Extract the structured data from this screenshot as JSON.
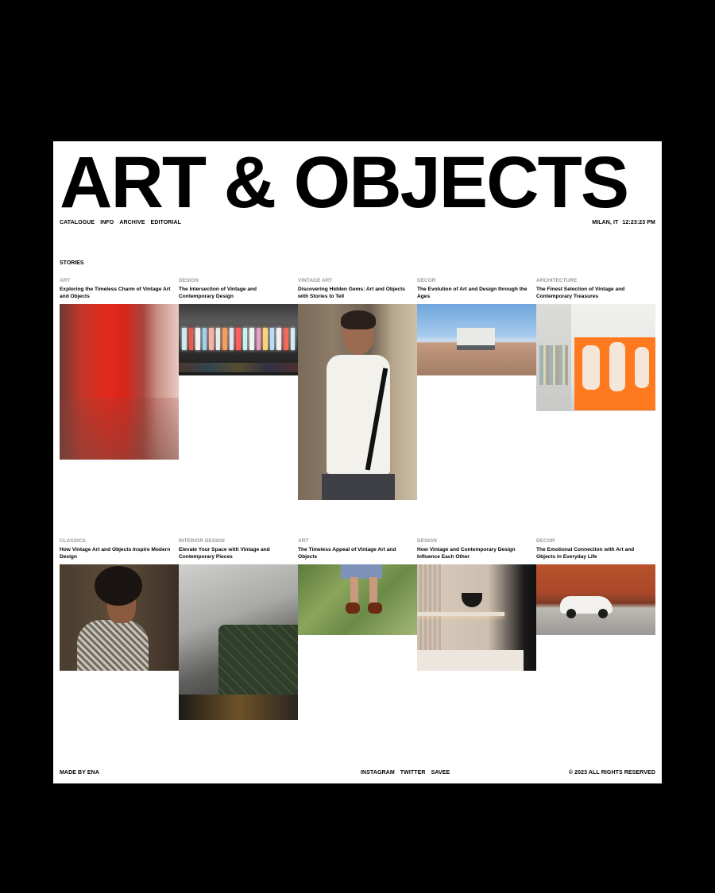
{
  "hero_title": "ART & OBJECTS",
  "nav": [
    "CATALOGUE",
    "INFO",
    "ARCHIVE",
    "EDITORIAL"
  ],
  "meta": {
    "location": "MILAN, IT",
    "time": "12:23:23 PM"
  },
  "stories_label": "STORIES",
  "stories": [
    {
      "category": "ART",
      "title": "Exploring the Timeless Charm of Vintage Art and Objects"
    },
    {
      "category": "DESIGN",
      "title": "The Intersection of Vintage and Contemporary Design"
    },
    {
      "category": "VINTAGE ART",
      "title": "Discovering Hidden Gems: Art and Objects with Stories to Tell"
    },
    {
      "category": "DECOR",
      "title": "The Evolution of Art and Design through the Ages"
    },
    {
      "category": "ARCHITECTURE",
      "title": "The Finest Selection of Vintage and Contemporary Treasures"
    },
    {
      "category": "CLASSICS",
      "title": "How Vintage Art and Objects Inspire Modern Design"
    },
    {
      "category": "INTERIOR DESIGN",
      "title": "Elevate Your Space with Vintage and Contemporary Pieces"
    },
    {
      "category": "ART",
      "title": "The Timeless Appeal of Vintage Art and Objects"
    },
    {
      "category": "DESIGN",
      "title": "How Vintage and Contemporary Design Influence Each Other"
    },
    {
      "category": "DECOR",
      "title": "The Emotional Connection with Art and Objects in Everyday Life"
    }
  ],
  "footer": {
    "made_by": "MADE BY ena",
    "social": [
      "INSTAGRAM",
      "TWITTER",
      "SAVEE"
    ],
    "rights": "© 2023 ALL RIGHTS RESERVED"
  },
  "colors": {
    "page": "#ffffff",
    "frame": "#000000",
    "category": "#9a9a9a"
  },
  "neon_colors": [
    "#cfe8f0",
    "#e85a4a",
    "#f2f2f2",
    "#9fd1e8",
    "#f7b2a6",
    "#e9e9e9",
    "#f59c5c",
    "#dfe9f5",
    "#ff5c5c",
    "#c9f0f0",
    "#f3f3f3",
    "#e6a0c8",
    "#fbd27a",
    "#b8dcf5",
    "#f0f0f0",
    "#ef6a5a",
    "#d2eef2"
  ]
}
